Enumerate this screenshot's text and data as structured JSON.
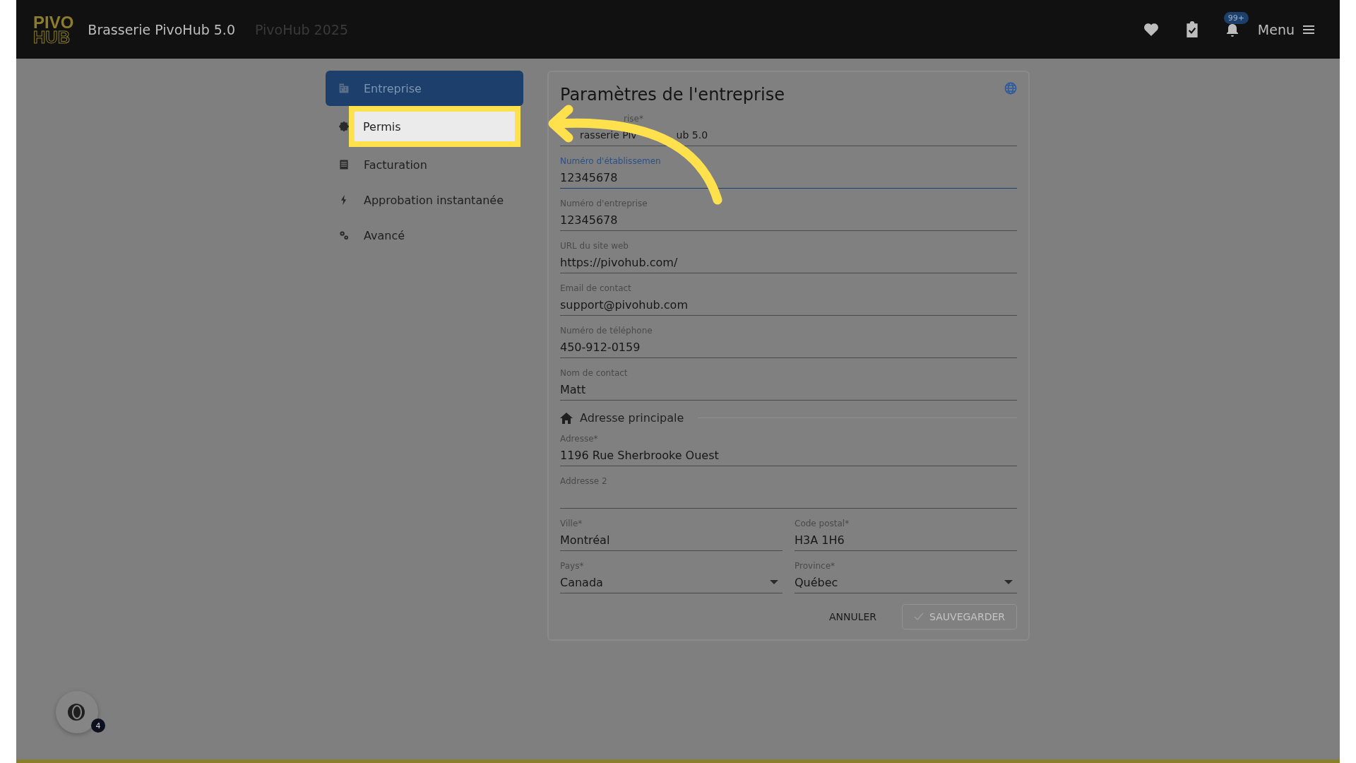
{
  "header": {
    "logo_top": "PIVO",
    "logo_bottom": "HUB",
    "title": "Brasserie PivoHub 5.0",
    "subtitle": "PivoHub 2025",
    "notification_badge": "99+",
    "menu_label": "Menu"
  },
  "sidebar": {
    "items": [
      {
        "label": "Entreprise",
        "selected": true,
        "spotlight": false
      },
      {
        "label": "Permis",
        "selected": false,
        "spotlight": true
      },
      {
        "label": "Facturation",
        "selected": false,
        "spotlight": false
      },
      {
        "label": "Approbation instantanée",
        "selected": false,
        "spotlight": false
      },
      {
        "label": "Avancé",
        "selected": false,
        "spotlight": false
      }
    ]
  },
  "form": {
    "title": "Paramètres de l'entreprise",
    "items": [
      {
        "kind": "field",
        "label": "rise*",
        "value": "rasserie Piv",
        "value_end": "ub 5.0",
        "focused": false
      },
      {
        "kind": "field",
        "label": "Numéro d'établissemen",
        "value": "12345678",
        "focused": true
      },
      {
        "kind": "field",
        "label": "Numéro d'entreprise",
        "value": "12345678",
        "focused": false
      },
      {
        "kind": "field",
        "label": "URL du site web",
        "value": "https://pivohub.com/",
        "focused": false
      },
      {
        "kind": "field",
        "label": "Email de contact",
        "value": "support@pivohub.com",
        "focused": false
      },
      {
        "kind": "field",
        "label": "Numéro de téléphone",
        "value": "450-912-0159",
        "focused": false
      },
      {
        "kind": "field",
        "label": "Nom de contact",
        "value": "Matt",
        "focused": false
      },
      {
        "kind": "section",
        "label": "Adresse principale"
      },
      {
        "kind": "field",
        "label": "Adresse*",
        "value": "1196 Rue Sherbrooke Ouest",
        "focused": false
      },
      {
        "kind": "field",
        "label": "Addresse 2",
        "focused": false
      },
      {
        "kind": "pair",
        "fields": [
          {
            "kind": "field",
            "label": "Ville*",
            "value": "Montréal",
            "focused": false
          },
          {
            "kind": "field",
            "label": "Code postal*",
            "value": "H3A 1H6",
            "focused": false
          }
        ]
      },
      {
        "kind": "pair",
        "fields": [
          {
            "kind": "select",
            "label": "Pays*",
            "value": "Canada",
            "focused": false
          },
          {
            "kind": "select",
            "label": "Province*",
            "value": "Québec",
            "focused": false
          }
        ]
      }
    ],
    "buttons": [
      {
        "label": "ANNULER",
        "kind": "text",
        "disabled": false
      },
      {
        "label": "SAUVEGARDER",
        "kind": "outlined",
        "disabled": true
      }
    ]
  },
  "chat_badge": "4"
}
